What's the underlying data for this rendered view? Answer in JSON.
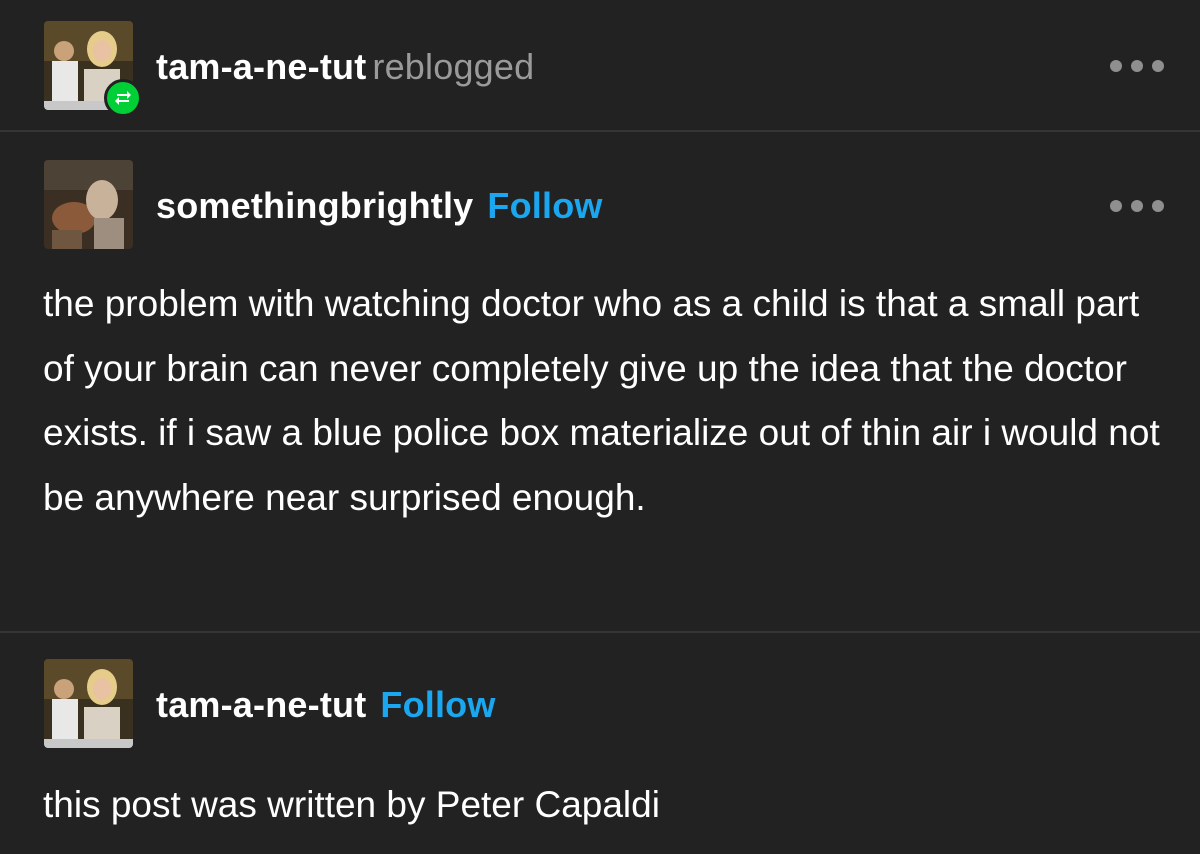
{
  "header": {
    "username": "tam-a-ne-tut",
    "action": "reblogged",
    "avatar_icon": "user-avatar-photo",
    "badge_icon": "reblog-icon",
    "badge_color": "#00cf35",
    "more_icon": "more-options-icon"
  },
  "original_post": {
    "username": "somethingbrightly",
    "follow_label": "Follow",
    "avatar_icon": "user-avatar-painting",
    "more_icon": "more-options-icon",
    "text": "the problem with watching doctor who as a child is that a small part of your brain can never completely give up the idea that the doctor exists. if i saw a blue police box materialize out of thin air i would not be anywhere near surprised enough."
  },
  "reply_post": {
    "username": "tam-a-ne-tut",
    "follow_label": "Follow",
    "avatar_icon": "user-avatar-photo",
    "text": "this post was written by Peter Capaldi"
  },
  "colors": {
    "background": "#222222",
    "divider": "#353535",
    "follow": "#1aa7f0",
    "secondary_text": "#9a9a9a"
  }
}
